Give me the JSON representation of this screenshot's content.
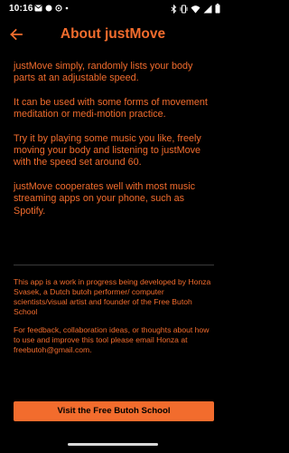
{
  "status_bar": {
    "time": "10:16",
    "icons_left": [
      "mail-icon",
      "circle-icon",
      "sync-icon",
      "dot-icon"
    ],
    "icons_right": [
      "bluetooth-icon",
      "vibrate-icon",
      "wifi-icon",
      "signal-icon",
      "battery-icon"
    ]
  },
  "app_bar": {
    "title": "About justMove",
    "back_icon": "arrow-back-icon"
  },
  "about": {
    "paragraphs": [
      "justMove simply, randomly lists your body parts at an adjustable speed.",
      "It can be used with some forms of movement meditation or medi-motion practice.",
      "Try it by playing some music you like, freely moving your body and listening to justMove with the speed set around 60.",
      "justMove cooperates well with most music streaming apps on your phone, such as Spotify."
    ]
  },
  "credits": {
    "author_note": "This app is a work in progress being developed by Honza Svasek, a Dutch butoh performer/ computer scientists/visual artist and founder of the Free Butoh School",
    "feedback_note": "For feedback, collaboration ideas, or thoughts about how to use and improve this tool please email Honza at freebutoh@gmail.com."
  },
  "cta": {
    "label": "Visit the Free Butoh School"
  },
  "colors": {
    "accent": "#f26c2d",
    "background": "#000000"
  }
}
